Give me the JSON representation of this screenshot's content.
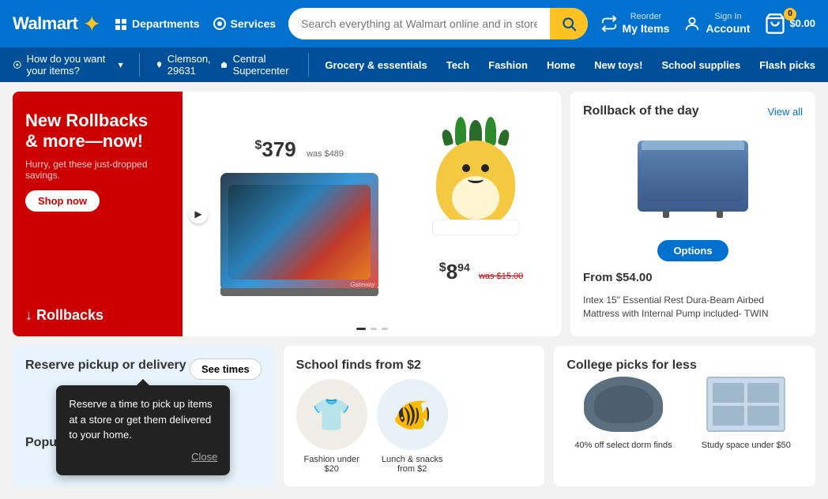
{
  "brand": {
    "name": "Walmart",
    "spark": "✦"
  },
  "topnav": {
    "departments_label": "Departments",
    "services_label": "Services",
    "search_placeholder": "Search everything at Walmart online and in store",
    "reorder_label": "Reorder",
    "my_items_label": "My Items",
    "signin_label": "Sign In",
    "account_label": "Account",
    "cart_price": "$0.00",
    "cart_badge": "0"
  },
  "deliverybar": {
    "delivery_question": "How do you want your items?",
    "location": "Clemson, 29631",
    "store": "Central Supercenter",
    "nav_links": [
      {
        "label": "Grocery & essentials"
      },
      {
        "label": "Tech"
      },
      {
        "label": "Fashion"
      },
      {
        "label": "Home"
      },
      {
        "label": "New toys!"
      },
      {
        "label": "School supplies"
      },
      {
        "label": "Flash picks"
      }
    ]
  },
  "hero": {
    "headline_line1": "New Rollbacks",
    "headline_line2": "& more—now!",
    "subtext": "Hurry, get these just-dropped savings.",
    "shop_now": "Shop now",
    "rollbacks_label": "↓ Rollbacks",
    "laptop_price": "$379",
    "laptop_was": "was $489",
    "squishmallow_price": "$8",
    "squishmallow_cents": "94",
    "squishmallow_was": "was $15.00",
    "gateway_brand": "Gateway"
  },
  "rollback_panel": {
    "title": "Rollback of the day",
    "view_all": "View all",
    "options_btn": "Options",
    "from_price": "From $54.00",
    "product_desc": "Intex 15\" Essential Rest Dura-Beam Airbed Mattress with Internal Pump included- TWIN"
  },
  "bottom": {
    "pickup_title": "Reserve pickup or delivery",
    "see_times": "See times",
    "tooltip_text": "Reserve a time to pick up items at a store or get them delivered to your home.",
    "tooltip_close": "Close",
    "school_title": "School finds from $2",
    "school_items": [
      {
        "label": "Fashion under $20"
      },
      {
        "label": "Lunch & snacks from $2"
      }
    ],
    "college_title": "College picks for less",
    "college_items": [
      {
        "label": "40% off select dorm finds"
      },
      {
        "label": "Study space under $50"
      }
    ],
    "popular_services_title": "Popular services"
  }
}
